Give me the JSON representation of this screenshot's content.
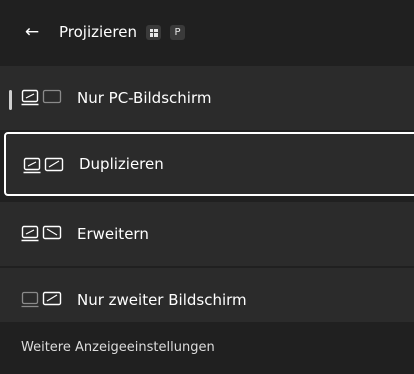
{
  "header": {
    "title": "Projizieren",
    "shortcut_key_p": "P"
  },
  "options": [
    {
      "label": "Nur PC-Bildschirm",
      "selected": false,
      "active": true
    },
    {
      "label": "Duplizieren",
      "selected": true,
      "active": false
    },
    {
      "label": "Erweitern",
      "selected": false,
      "active": false
    },
    {
      "label": "Nur zweiter Bildschirm",
      "selected": false,
      "active": false
    }
  ],
  "footer": {
    "link": "Weitere Anzeigeeinstellungen"
  },
  "colors": {
    "background": "#202020",
    "option_background": "#2b2b2b",
    "selection_border": "#ffffff"
  }
}
